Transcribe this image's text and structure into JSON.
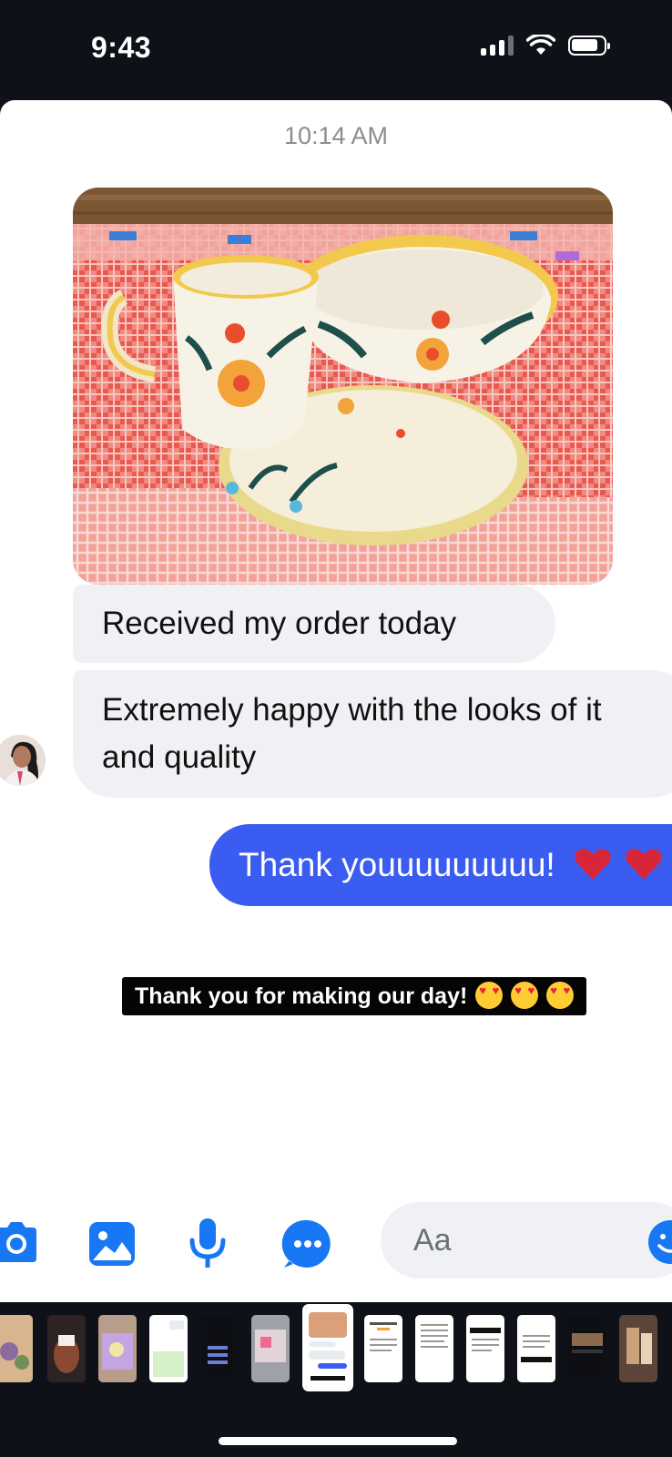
{
  "status_bar": {
    "time": "9:43",
    "icons": [
      "cellular-signal-icon",
      "wifi-icon",
      "battery-icon"
    ]
  },
  "conversation": {
    "timestamp": "10:14 AM",
    "photo": {
      "description": "hand-painted floral ceramic mug, saucer and bowl on a checked tablecloth"
    },
    "incoming_messages": [
      "Received my order today",
      "Extremely happy with the looks of it and quality"
    ],
    "outgoing_message": "Thank youuuuuuuuu!",
    "outgoing_emoji": [
      "red-heart",
      "red-heart"
    ],
    "sticker_caption": "Thank you for making our day!",
    "sticker_emoji": [
      "heart-eyes",
      "heart-eyes",
      "heart-eyes"
    ]
  },
  "composer": {
    "placeholder": "Aa",
    "buttons": [
      "camera-icon",
      "gallery-icon",
      "microphone-icon",
      "more-options-icon",
      "emoji-icon"
    ]
  },
  "colors": {
    "outgoing_bubble": "#3b5cf0",
    "incoming_bubble": "#f0f1f4",
    "accent_icon": "#1877f2",
    "background_dark": "#0e1117"
  },
  "thumbnail_tray": {
    "count": 13,
    "selected_index": 6
  }
}
